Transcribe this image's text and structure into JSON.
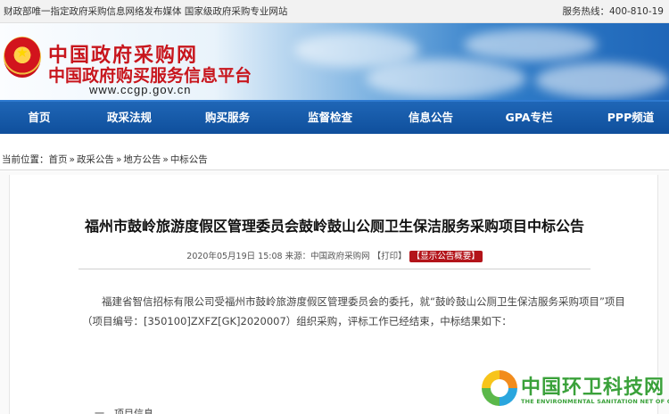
{
  "topbar": {
    "left_text": "财政部唯一指定政府采购信息网络发布媒体 国家级政府采购专业网站",
    "hotline": "服务热线：400-810-19"
  },
  "header": {
    "title_cn": "中国政府采购网",
    "subtitle_cn": "中国政府购买服务信息平台",
    "url": "www.ccgp.gov.cn"
  },
  "nav": {
    "items": [
      {
        "label": "首页"
      },
      {
        "label": "政采法规"
      },
      {
        "label": "购买服务"
      },
      {
        "label": "监督检查"
      },
      {
        "label": "信息公告"
      },
      {
        "label": "GPA专栏"
      },
      {
        "label": "PPP频道"
      }
    ]
  },
  "breadcrumb": {
    "prefix": "当前位置：",
    "items": [
      {
        "label": "首页"
      },
      {
        "label": "政采公告"
      },
      {
        "label": "地方公告"
      },
      {
        "label": "中标公告"
      }
    ],
    "separator": "»"
  },
  "article": {
    "title": "福州市鼓岭旅游度假区管理委员会鼓岭鼓山公厕卫生保洁服务采购项目中标公告",
    "date": "2020年05月19日 15:08",
    "source_label": "来源：",
    "source": "中国政府采购网",
    "print_label": "【打印】",
    "summary_button": "【显示公告概要】",
    "paragraph": "福建省智信招标有限公司受福州市鼓岭旅游度假区管理委员会的委托，就“鼓岭鼓山公厕卫生保洁服务采购项目”项目（项目编号：[350100]ZXFZ[GK]2020007）组织采购，评标工作已经结束，中标结果如下：",
    "next_heading_fragment": "一、项目信息"
  },
  "watermark": {
    "title": "中国环卫科技网",
    "subtitle": "THE ENVIRONMENTAL SANITATION NET OF CHINA"
  }
}
